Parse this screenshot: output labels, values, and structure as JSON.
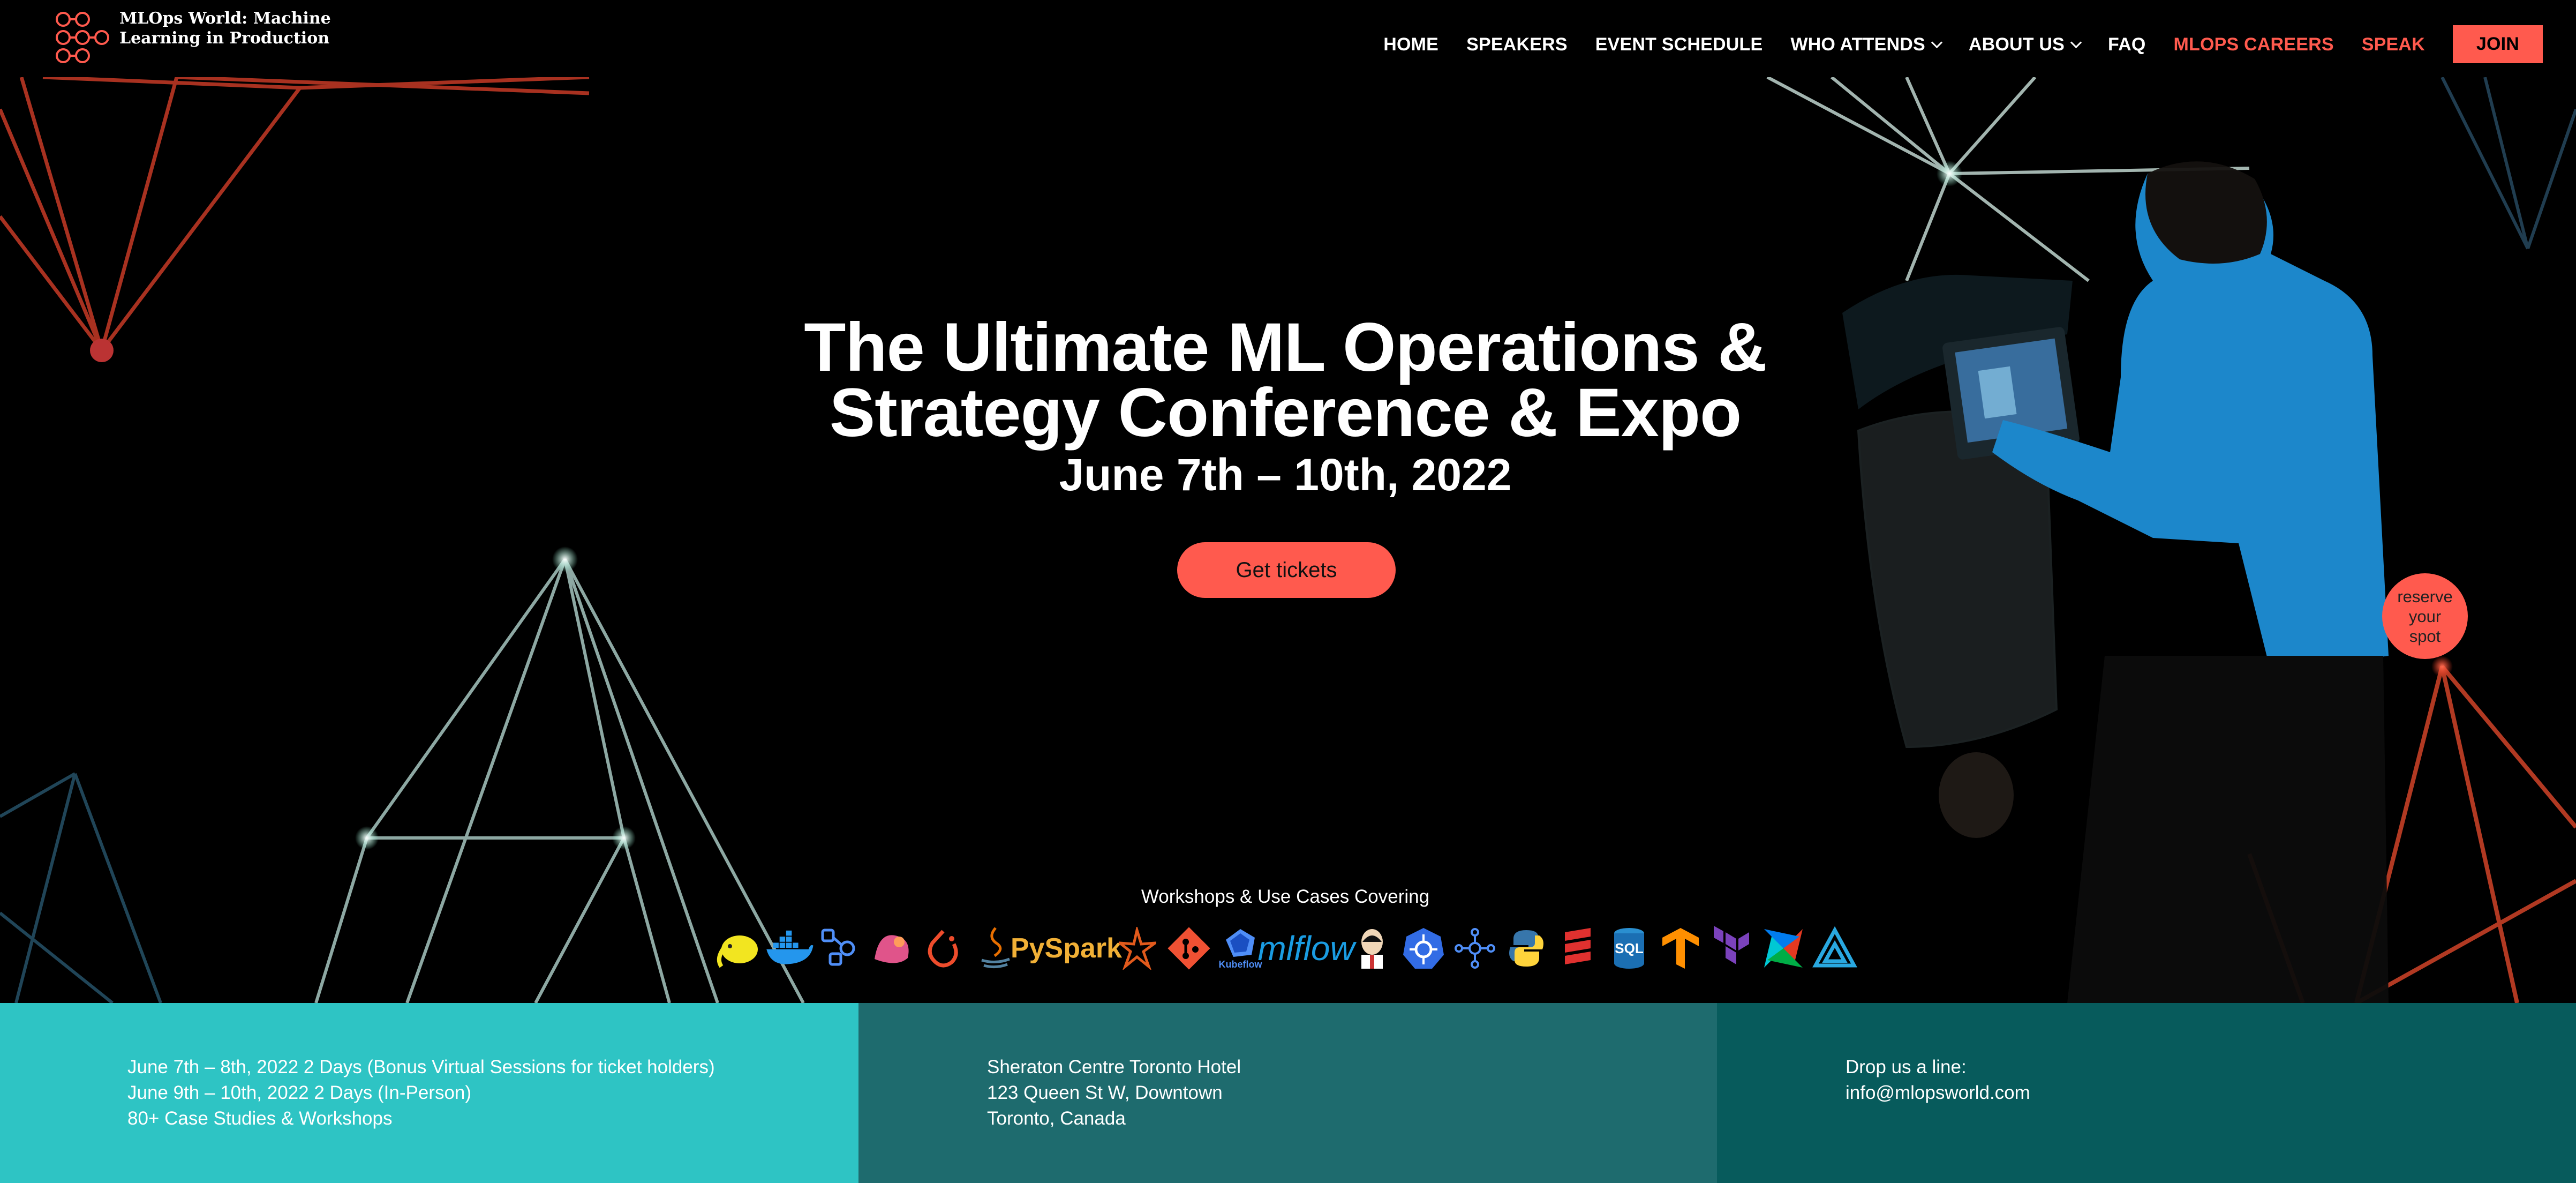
{
  "site": {
    "logo_text": "MLOps World: Machine Learning in Production"
  },
  "nav": {
    "items": [
      {
        "label": "HOME",
        "dropdown": false,
        "accent": false
      },
      {
        "label": "SPEAKERS",
        "dropdown": false,
        "accent": false
      },
      {
        "label": "EVENT SCHEDULE",
        "dropdown": false,
        "accent": false
      },
      {
        "label": "WHO ATTENDS",
        "dropdown": true,
        "accent": false
      },
      {
        "label": "ABOUT US",
        "dropdown": true,
        "accent": false
      },
      {
        "label": "FAQ",
        "dropdown": false,
        "accent": false
      },
      {
        "label": "MLOPS CAREERS",
        "dropdown": false,
        "accent": true
      },
      {
        "label": "SPEAK",
        "dropdown": false,
        "accent": true
      }
    ],
    "join_label": "JOIN"
  },
  "hero": {
    "title_line1": "The Ultimate ML Operations &",
    "title_line2": "Strategy Conference & Expo",
    "dates": "June 7th – 10th, 2022",
    "cta_label": "Get tickets",
    "reserve_label": "reserve your spot",
    "workshops_label": "Workshops & Use Cases Covering",
    "tool_icons": [
      "hadoop-elephant-icon",
      "docker-icon",
      "kubeflow-pipelines-icon",
      "seldon-icon",
      "pytorch-icon",
      "java-icon",
      "pyspark-icon",
      "spark-star-icon",
      "git-icon",
      "kubeflow-icon",
      "mlflow-icon",
      "jenkins-icon",
      "kubernetes-icon",
      "graph-nodes-icon",
      "python-icon",
      "stack-icon",
      "sql-database-icon",
      "tensorflow-icon",
      "terraform-icon",
      "airflow-icon",
      "azure-ml-icon"
    ],
    "tool_labels": {
      "pyspark": "PySpark",
      "kubeflow": "Kubeflow",
      "mlflow": "mlflow",
      "sql": "SQL"
    }
  },
  "footer": {
    "dates_col": [
      "June 7th – 8th, 2022 2 Days (Bonus Virtual Sessions for ticket holders)",
      "June 9th – 10th, 2022 2 Days (In-Person)",
      "80+ Case Studies & Workshops"
    ],
    "venue_col": [
      "Sheraton Centre Toronto Hotel",
      "123 Queen St W, Downtown",
      "Toronto, Canada"
    ],
    "contact_col": [
      "Drop us a line:",
      "info@mlopsworld.com"
    ]
  },
  "colors": {
    "accent": "#ff5a4e",
    "teal_light": "#2ec4c4",
    "teal_mid": "#1e6b6e",
    "teal_dark": "#075b5c",
    "speaker_jacket": "#1e8fd6"
  }
}
